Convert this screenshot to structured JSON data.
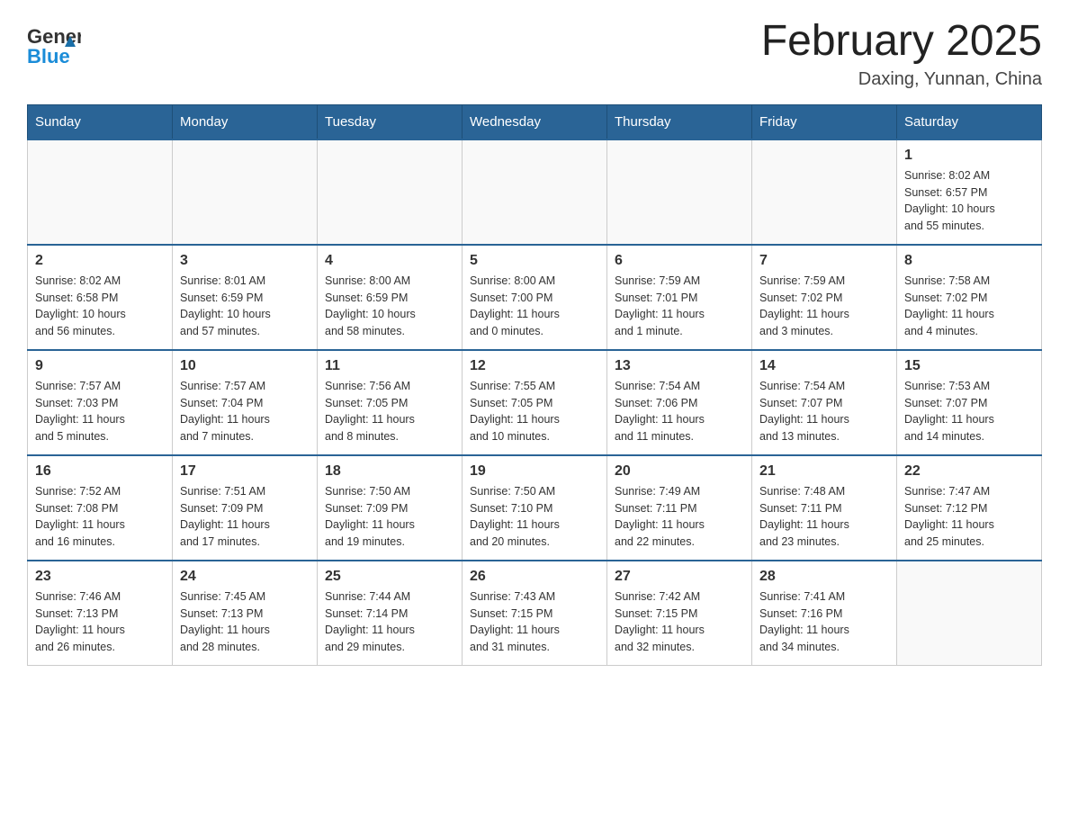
{
  "header": {
    "logo_general": "General",
    "logo_blue": "Blue",
    "month_title": "February 2025",
    "location": "Daxing, Yunnan, China"
  },
  "weekdays": [
    "Sunday",
    "Monday",
    "Tuesday",
    "Wednesday",
    "Thursday",
    "Friday",
    "Saturday"
  ],
  "weeks": [
    [
      {
        "day": "",
        "info": ""
      },
      {
        "day": "",
        "info": ""
      },
      {
        "day": "",
        "info": ""
      },
      {
        "day": "",
        "info": ""
      },
      {
        "day": "",
        "info": ""
      },
      {
        "day": "",
        "info": ""
      },
      {
        "day": "1",
        "info": "Sunrise: 8:02 AM\nSunset: 6:57 PM\nDaylight: 10 hours\nand 55 minutes."
      }
    ],
    [
      {
        "day": "2",
        "info": "Sunrise: 8:02 AM\nSunset: 6:58 PM\nDaylight: 10 hours\nand 56 minutes."
      },
      {
        "day": "3",
        "info": "Sunrise: 8:01 AM\nSunset: 6:59 PM\nDaylight: 10 hours\nand 57 minutes."
      },
      {
        "day": "4",
        "info": "Sunrise: 8:00 AM\nSunset: 6:59 PM\nDaylight: 10 hours\nand 58 minutes."
      },
      {
        "day": "5",
        "info": "Sunrise: 8:00 AM\nSunset: 7:00 PM\nDaylight: 11 hours\nand 0 minutes."
      },
      {
        "day": "6",
        "info": "Sunrise: 7:59 AM\nSunset: 7:01 PM\nDaylight: 11 hours\nand 1 minute."
      },
      {
        "day": "7",
        "info": "Sunrise: 7:59 AM\nSunset: 7:02 PM\nDaylight: 11 hours\nand 3 minutes."
      },
      {
        "day": "8",
        "info": "Sunrise: 7:58 AM\nSunset: 7:02 PM\nDaylight: 11 hours\nand 4 minutes."
      }
    ],
    [
      {
        "day": "9",
        "info": "Sunrise: 7:57 AM\nSunset: 7:03 PM\nDaylight: 11 hours\nand 5 minutes."
      },
      {
        "day": "10",
        "info": "Sunrise: 7:57 AM\nSunset: 7:04 PM\nDaylight: 11 hours\nand 7 minutes."
      },
      {
        "day": "11",
        "info": "Sunrise: 7:56 AM\nSunset: 7:05 PM\nDaylight: 11 hours\nand 8 minutes."
      },
      {
        "day": "12",
        "info": "Sunrise: 7:55 AM\nSunset: 7:05 PM\nDaylight: 11 hours\nand 10 minutes."
      },
      {
        "day": "13",
        "info": "Sunrise: 7:54 AM\nSunset: 7:06 PM\nDaylight: 11 hours\nand 11 minutes."
      },
      {
        "day": "14",
        "info": "Sunrise: 7:54 AM\nSunset: 7:07 PM\nDaylight: 11 hours\nand 13 minutes."
      },
      {
        "day": "15",
        "info": "Sunrise: 7:53 AM\nSunset: 7:07 PM\nDaylight: 11 hours\nand 14 minutes."
      }
    ],
    [
      {
        "day": "16",
        "info": "Sunrise: 7:52 AM\nSunset: 7:08 PM\nDaylight: 11 hours\nand 16 minutes."
      },
      {
        "day": "17",
        "info": "Sunrise: 7:51 AM\nSunset: 7:09 PM\nDaylight: 11 hours\nand 17 minutes."
      },
      {
        "day": "18",
        "info": "Sunrise: 7:50 AM\nSunset: 7:09 PM\nDaylight: 11 hours\nand 19 minutes."
      },
      {
        "day": "19",
        "info": "Sunrise: 7:50 AM\nSunset: 7:10 PM\nDaylight: 11 hours\nand 20 minutes."
      },
      {
        "day": "20",
        "info": "Sunrise: 7:49 AM\nSunset: 7:11 PM\nDaylight: 11 hours\nand 22 minutes."
      },
      {
        "day": "21",
        "info": "Sunrise: 7:48 AM\nSunset: 7:11 PM\nDaylight: 11 hours\nand 23 minutes."
      },
      {
        "day": "22",
        "info": "Sunrise: 7:47 AM\nSunset: 7:12 PM\nDaylight: 11 hours\nand 25 minutes."
      }
    ],
    [
      {
        "day": "23",
        "info": "Sunrise: 7:46 AM\nSunset: 7:13 PM\nDaylight: 11 hours\nand 26 minutes."
      },
      {
        "day": "24",
        "info": "Sunrise: 7:45 AM\nSunset: 7:13 PM\nDaylight: 11 hours\nand 28 minutes."
      },
      {
        "day": "25",
        "info": "Sunrise: 7:44 AM\nSunset: 7:14 PM\nDaylight: 11 hours\nand 29 minutes."
      },
      {
        "day": "26",
        "info": "Sunrise: 7:43 AM\nSunset: 7:15 PM\nDaylight: 11 hours\nand 31 minutes."
      },
      {
        "day": "27",
        "info": "Sunrise: 7:42 AM\nSunset: 7:15 PM\nDaylight: 11 hours\nand 32 minutes."
      },
      {
        "day": "28",
        "info": "Sunrise: 7:41 AM\nSunset: 7:16 PM\nDaylight: 11 hours\nand 34 minutes."
      },
      {
        "day": "",
        "info": ""
      }
    ]
  ]
}
